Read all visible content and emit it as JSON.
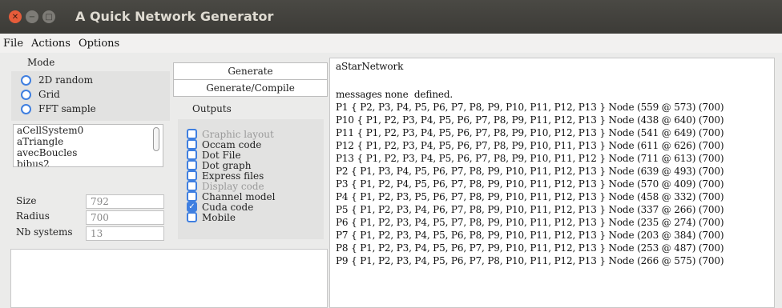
{
  "window": {
    "title": "A Quick Network Generator"
  },
  "menu": [
    "File",
    "Actions",
    "Options"
  ],
  "mode": {
    "label": "Mode",
    "options": [
      "2D random",
      "Grid",
      "FFT sample"
    ]
  },
  "systems_list": [
    "aCellSystem0",
    "aTriangle",
    "avecBoucles",
    "bibus2"
  ],
  "fields": [
    {
      "label": "Size",
      "value": "792"
    },
    {
      "label": "Radius",
      "value": "700"
    },
    {
      "label": "Nb systems",
      "value": "13"
    }
  ],
  "buttons": {
    "generate": "Generate",
    "generate_compile": "Generate/Compile"
  },
  "outputs": {
    "label": "Outputs",
    "items": [
      {
        "label": "Graphic layout",
        "checked": false,
        "disabled": true
      },
      {
        "label": "Occam code",
        "checked": false,
        "disabled": false
      },
      {
        "label": "Dot File",
        "checked": false,
        "disabled": false
      },
      {
        "label": "Dot graph",
        "checked": false,
        "disabled": false
      },
      {
        "label": "Express files",
        "checked": false,
        "disabled": false
      },
      {
        "label": "Display code",
        "checked": false,
        "disabled": true
      },
      {
        "label": "Channel model",
        "checked": false,
        "disabled": false
      },
      {
        "label": "Cuda code",
        "checked": true,
        "disabled": false
      },
      {
        "label": "Mobile",
        "checked": false,
        "disabled": false
      }
    ]
  },
  "text_area": {
    "lines": [
      "aStarNetwork",
      "",
      "messages none  defined.",
      "P1 { P2, P3, P4, P5, P6, P7, P8, P9, P10, P11, P12, P13 } Node (559 @ 573) (700)",
      "P10 { P1, P2, P3, P4, P5, P6, P7, P8, P9, P11, P12, P13 } Node (438 @ 640) (700)",
      "P11 { P1, P2, P3, P4, P5, P6, P7, P8, P9, P10, P12, P13 } Node (541 @ 649) (700)",
      "P12 { P1, P2, P3, P4, P5, P6, P7, P8, P9, P10, P11, P13 } Node (611 @ 626) (700)",
      "P13 { P1, P2, P3, P4, P5, P6, P7, P8, P9, P10, P11, P12 } Node (711 @ 613) (700)",
      "P2 { P1, P3, P4, P5, P6, P7, P8, P9, P10, P11, P12, P13 } Node (639 @ 493) (700)",
      "P3 { P1, P2, P4, P5, P6, P7, P8, P9, P10, P11, P12, P13 } Node (570 @ 409) (700)",
      "P4 { P1, P2, P3, P5, P6, P7, P8, P9, P10, P11, P12, P13 } Node (458 @ 332) (700)",
      "P5 { P1, P2, P3, P4, P6, P7, P8, P9, P10, P11, P12, P13 } Node (337 @ 266) (700)",
      "P6 { P1, P2, P3, P4, P5, P7, P8, P9, P10, P11, P12, P13 } Node (235 @ 274) (700)",
      "P7 { P1, P2, P3, P4, P5, P6, P8, P9, P10, P11, P12, P13 } Node (203 @ 384) (700)",
      "P8 { P1, P2, P3, P4, P5, P6, P7, P9, P10, P11, P12, P13 } Node (253 @ 487) (700)",
      "P9 { P1, P2, P3, P4, P5, P6, P7, P8, P10, P11, P12, P13 } Node (266 @ 575) (700)"
    ]
  },
  "colors": {
    "accent": "#3f7fe0",
    "titlebar": "#3c3b37",
    "close": "#e65c3a"
  }
}
